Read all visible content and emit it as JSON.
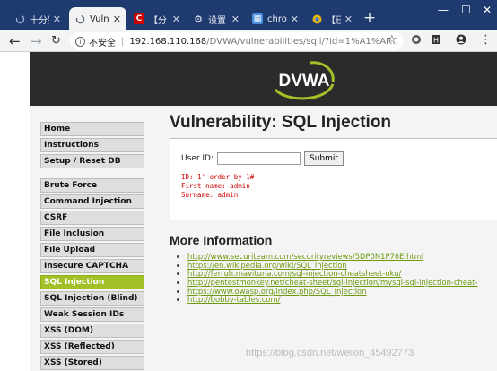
{
  "browser": {
    "tabs": [
      {
        "title": "十分钟",
        "active": false,
        "icon": "loading-icon"
      },
      {
        "title": "Vulne",
        "active": true,
        "icon": "loading-icon"
      },
      {
        "title": "【分",
        "active": false,
        "icon": "csdn-icon"
      },
      {
        "title": "设置",
        "active": false,
        "icon": "gear-icon"
      },
      {
        "title": "chrom",
        "active": false,
        "icon": "puzzle-icon"
      },
      {
        "title": "【已",
        "active": false,
        "icon": "chrome-icon"
      }
    ],
    "url_security": "不安全",
    "url_host": "192.168.110.168",
    "url_path": "/DVWA/vulnerabilities/sqli/?id=1%A1%AF..."
  },
  "logo": {
    "text": "DVWA"
  },
  "menu": {
    "group1": [
      "Home",
      "Instructions",
      "Setup / Reset DB"
    ],
    "group2": [
      "Brute Force",
      "Command Injection",
      "CSRF",
      "File Inclusion",
      "File Upload",
      "Insecure CAPTCHA",
      "SQL Injection",
      "SQL Injection (Blind)",
      "Weak Session IDs",
      "XSS (DOM)",
      "XSS (Reflected)",
      "XSS (Stored)"
    ],
    "active": "SQL Injection"
  },
  "main": {
    "title": "Vulnerability: SQL Injection",
    "form": {
      "label": "User ID:",
      "value": "",
      "submit": "Submit"
    },
    "output": [
      "ID: 1' order by 1#",
      "First name: admin",
      "Surname: admin"
    ],
    "more_title": "More Information",
    "links": [
      "http://www.securiteam.com/securityreviews/5DP0N1P76E.html",
      "https://en.wikipedia.org/wiki/SQL_injection",
      "http://ferruh.mavituna.com/sql-injection-cheatsheet-oku/",
      "http://pentestmonkey.net/cheat-sheet/sql-injection/mysql-sql-injection-cheat-",
      "https://www.owasp.org/index.php/SQL_Injection",
      "http://bobby-tables.com/"
    ]
  },
  "watermark": "https://blog.csdn.net/weixin_45492773",
  "colors": {
    "accent": "#a2c128",
    "header": "#2b2b2b",
    "tabstrip": "#1f3a6e",
    "link": "#6d9a0e",
    "output": "#cc0000"
  }
}
